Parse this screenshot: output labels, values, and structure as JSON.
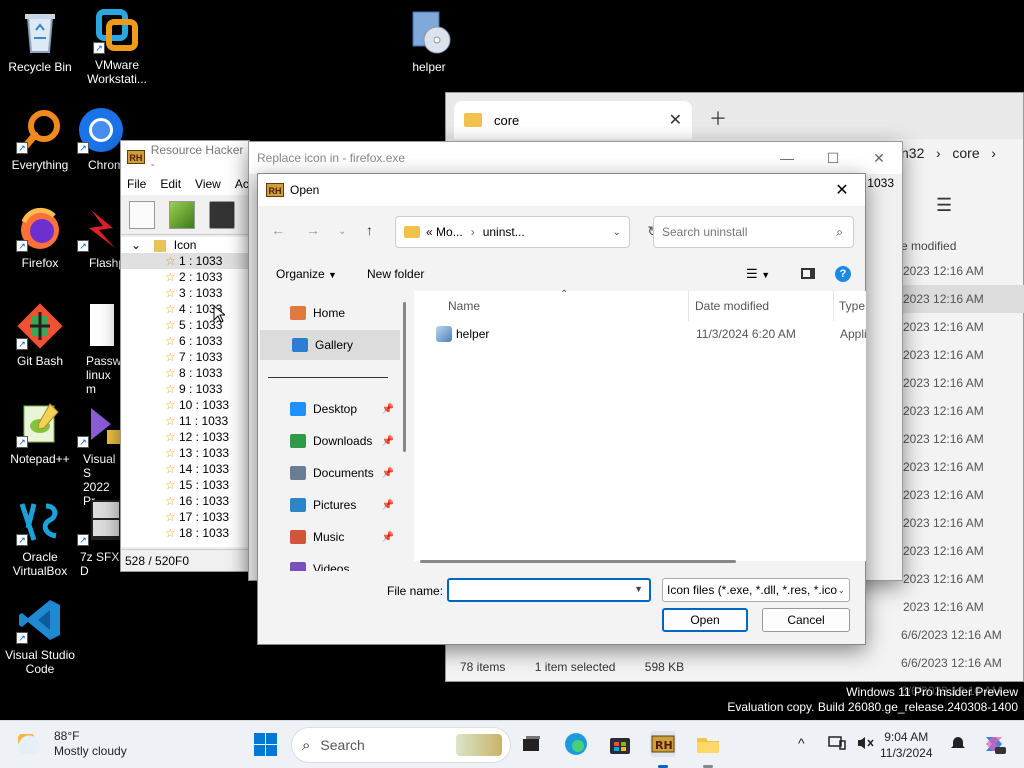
{
  "desktop_icons": [
    {
      "label": "Recycle Bin"
    },
    {
      "label": "VMware Workstati..."
    },
    {
      "label": "helper"
    },
    {
      "label": "Everything"
    },
    {
      "label": "Chrom"
    },
    {
      "label": "Firefox"
    },
    {
      "label": "Flashp"
    },
    {
      "label": "Git Bash"
    },
    {
      "label": "Passwo linux m"
    },
    {
      "label": "Notepad++"
    },
    {
      "label": "Visual S 2022 Pr"
    },
    {
      "label": "Oracle VirtualBox"
    },
    {
      "label": "7z SFX D"
    },
    {
      "label": "Visual Studio Code"
    }
  ],
  "explorer": {
    "tab_title": "core",
    "address_tail": "n32",
    "address_sep": "›",
    "address_folder": "core",
    "col_header": "e modified",
    "dates": [
      "2023 12:16 AM",
      "2023 12:16 AM",
      "2023 12:16 AM",
      "2023 12:16 AM",
      "2023 12:16 AM",
      "2023 12:16 AM",
      "2023 12:16 AM",
      "2023 12:16 AM",
      "2023 12:16 AM",
      "2023 12:16 AM",
      "2023 12:16 AM",
      "2023 12:16 AM",
      "2023 12:16 AM",
      "6/6/2023 12:16 AM",
      "6/6/2023 12:16 AM",
      "6/6/2023 12:16 AM"
    ],
    "status_items": "78 items",
    "status_selected": "1 item selected",
    "status_size": "598 KB"
  },
  "resource_hacker": {
    "title": "Resource Hacker -",
    "logo_text": "RH",
    "menu": [
      "File",
      "Edit",
      "View",
      "Act"
    ],
    "tree_root": "Icon",
    "tree_items": [
      "1 : 1033",
      "2 : 1033",
      "3 : 1033",
      "4 : 1033",
      "5 : 1033",
      "6 : 1033",
      "7 : 1033",
      "8 : 1033",
      "9 : 1033",
      "10 : 1033",
      "11 : 1033",
      "12 : 1033",
      "13 : 1033",
      "14 : 1033",
      "15 : 1033",
      "16 : 1033",
      "17 : 1033",
      "18 : 1033"
    ],
    "status": "528 / 520F0",
    "right_edge_text": "1033"
  },
  "replace_window": {
    "title": "Replace icon in - firefox.exe",
    "minimize": "—",
    "maximize": "☐",
    "close": "✕"
  },
  "open_dialog": {
    "title": "Open",
    "logo_text": "RH",
    "close": "✕",
    "breadcrumb_prefix": "«",
    "breadcrumb_1": "Mo...",
    "breadcrumb_sep": "›",
    "breadcrumb_2": "uninst...",
    "search_placeholder": "Search uninstall",
    "organize_label": "Organize",
    "new_folder_label": "New folder",
    "nav_items": [
      {
        "label": "Home",
        "color": "#e07a3c"
      },
      {
        "label": "Gallery",
        "color": "#2d7dd2"
      },
      {
        "label": "Desktop",
        "color": "#1e90ff"
      },
      {
        "label": "Downloads",
        "color": "#2e9a4a"
      },
      {
        "label": "Documents",
        "color": "#6a7d92"
      },
      {
        "label": "Pictures",
        "color": "#2a86c8"
      },
      {
        "label": "Music",
        "color": "#d0553a"
      },
      {
        "label": "Videos",
        "color": "#7a4fbf"
      }
    ],
    "columns": {
      "name": "Name",
      "date": "Date modified",
      "type": "Type"
    },
    "files": [
      {
        "name": "helper",
        "date": "11/3/2024 6:20 AM",
        "type": "Appli"
      }
    ],
    "file_name_label": "File name:",
    "file_name_value": "",
    "filter_value": "Icon files (*.exe, *.dll, *.res, *.ico",
    "open_button": "Open",
    "cancel_button": "Cancel"
  },
  "watermark": {
    "line1": "Windows 11 Pro Insider Preview",
    "line2": "Evaluation copy. Build 26080.ge_release.240308-1400"
  },
  "taskbar": {
    "temperature": "88°F",
    "weather": "Mostly cloudy",
    "search_label": "Search",
    "time": "9:04 AM",
    "date": "11/3/2024",
    "accent": "#0067c0"
  }
}
